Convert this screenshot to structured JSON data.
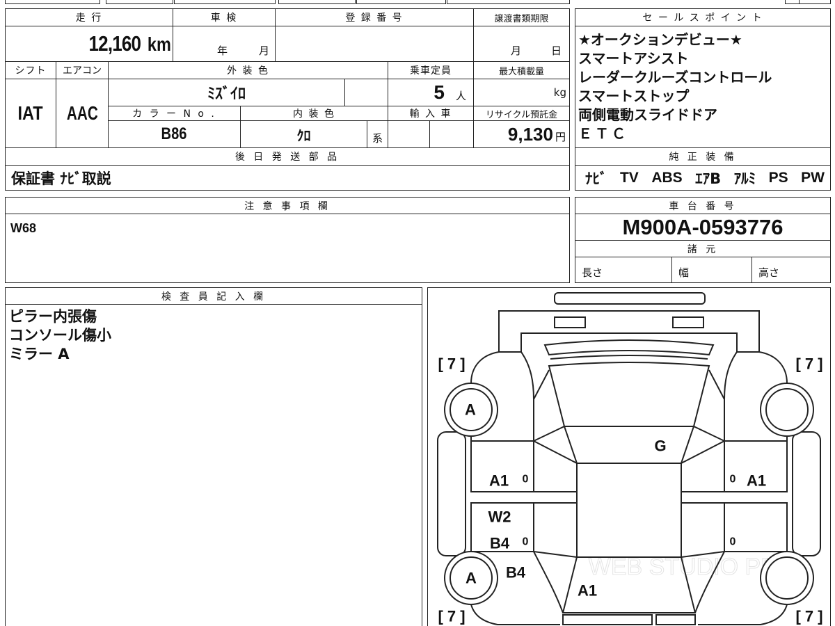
{
  "colors": {
    "border": "#222222",
    "text": "#111111",
    "background": "#ffffff"
  },
  "vehicle": {
    "headers": {
      "mileage": "走 行",
      "inspection": "車 検",
      "registration": "登 録 番 号",
      "doc_deadline": "譲渡書類期限",
      "shift": "シフト",
      "aircon": "エアコン",
      "ext_color": "外 装 色",
      "capacity": "乗車定員",
      "max_load": "最大積載量",
      "color_no": "カ ラ ー N o .",
      "int_color": "内 装 色",
      "import": "輸 入 車",
      "recycle": "リサイクル預託金",
      "parts": "後 日 発 送 部 品"
    },
    "mileage_value": "12,160",
    "mileage_unit": "km",
    "inspection_year_label": "年",
    "inspection_month_label": "月",
    "doc_month_label": "月",
    "doc_day_label": "日",
    "shift": "IAT",
    "aircon": "AAC",
    "ext_color": "ﾐｽﾞｲﾛ",
    "capacity": "5",
    "capacity_unit": "人",
    "max_load_unit": "kg",
    "color_no": "B86",
    "int_color": "ｸﾛ",
    "int_color_suffix": "系",
    "recycle_fee": "9,130",
    "recycle_unit": "円",
    "parts": "保証書 ﾅﾋﾞ取説"
  },
  "sales_points": {
    "header": "セ ー ル ス ポ イ ン ト",
    "items": [
      "★オークションデビュー★",
      "スマートアシスト",
      "レーダークルーズコントロール",
      "スマートストップ",
      "両側電動スライドドア",
      "ＥＴＣ"
    ]
  },
  "equipment": {
    "header": "純 正 装 備",
    "items": [
      "ﾅﾋﾞ",
      "TV",
      "ABS",
      "ｴｱB",
      "ｱﾙﾐ",
      "PS",
      "PW"
    ]
  },
  "notes": {
    "header": "注 意 事 項 欄",
    "text": "W68"
  },
  "chassis": {
    "header": "車 台 番 号",
    "number": "M900A-0593776",
    "spec_header": "諸 元",
    "length_label": "長さ",
    "width_label": "幅",
    "height_label": "高さ"
  },
  "inspector": {
    "header": "検 査 員 記 入 欄",
    "lines": [
      "ピラー内張傷",
      "コンソール傷小",
      "ミラー A"
    ]
  },
  "diagram": {
    "corner_labels": [
      "[ 7 ]",
      "[ 7 ]",
      "[ 7 ]",
      "[ 7 ]"
    ],
    "marks": {
      "upper_left_wheel": "A",
      "lower_left_wheel": "A",
      "roof": "G",
      "left_rear_door": "A1",
      "left_rear_door_dent": "0",
      "right_rear_door_dent": "0",
      "right_rear_door": "A1",
      "left_step": "W2",
      "left_front_door": "B4",
      "left_front_door_dent": "0",
      "right_front_door_dent": "0",
      "left_fender": "B4",
      "hood": "A1"
    },
    "watermark": "WEB STUDIO PRO"
  }
}
